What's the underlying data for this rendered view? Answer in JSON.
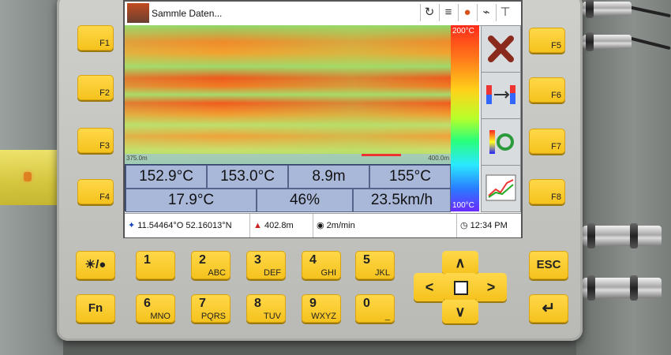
{
  "status": {
    "text": "Sammle Daten...",
    "icons": [
      "refresh-icon",
      "layers-icon",
      "compass-icon",
      "satellite-dish-icon",
      "sensor-icon"
    ]
  },
  "thermal": {
    "start_distance": "375.0m",
    "end_distance": "400.0m",
    "scale_max": "200°C",
    "scale_min": "100°C"
  },
  "readings": {
    "row1": [
      "152.9°C",
      "153.0°C",
      "8.9m",
      "155°C"
    ],
    "row2": [
      "17.9°C",
      "46%",
      "23.5km/h"
    ]
  },
  "bottom": {
    "gps": "11.54464°O 52.16013°N",
    "elevation": "402.8m",
    "speed": "2m/min",
    "time": "12:34 PM"
  },
  "side_buttons": [
    "cancel-icon",
    "swap-icon",
    "refresh-scale-icon",
    "chart-icon"
  ],
  "fkeys_left": [
    "F1",
    "F2",
    "F3",
    "F4"
  ],
  "fkeys_right": [
    "F5",
    "F6",
    "F7",
    "F8"
  ],
  "keypad": [
    {
      "num": "1",
      "sub": ""
    },
    {
      "num": "2",
      "sub": "ABC"
    },
    {
      "num": "3",
      "sub": "DEF"
    },
    {
      "num": "4",
      "sub": "GHI"
    },
    {
      "num": "5",
      "sub": "JKL"
    },
    {
      "num": "6",
      "sub": "MNO"
    },
    {
      "num": "7",
      "sub": "PQRS"
    },
    {
      "num": "8",
      "sub": "TUV"
    },
    {
      "num": "9",
      "sub": "WXYZ"
    },
    {
      "num": "0",
      "sub": "_"
    }
  ],
  "special_keys": {
    "fn": "Fn",
    "esc": "ESC",
    "enter": "↵",
    "brightness": "☀/●"
  },
  "dpad": {
    "up": "∧",
    "down": "∨",
    "left": "<",
    "right": ">"
  }
}
